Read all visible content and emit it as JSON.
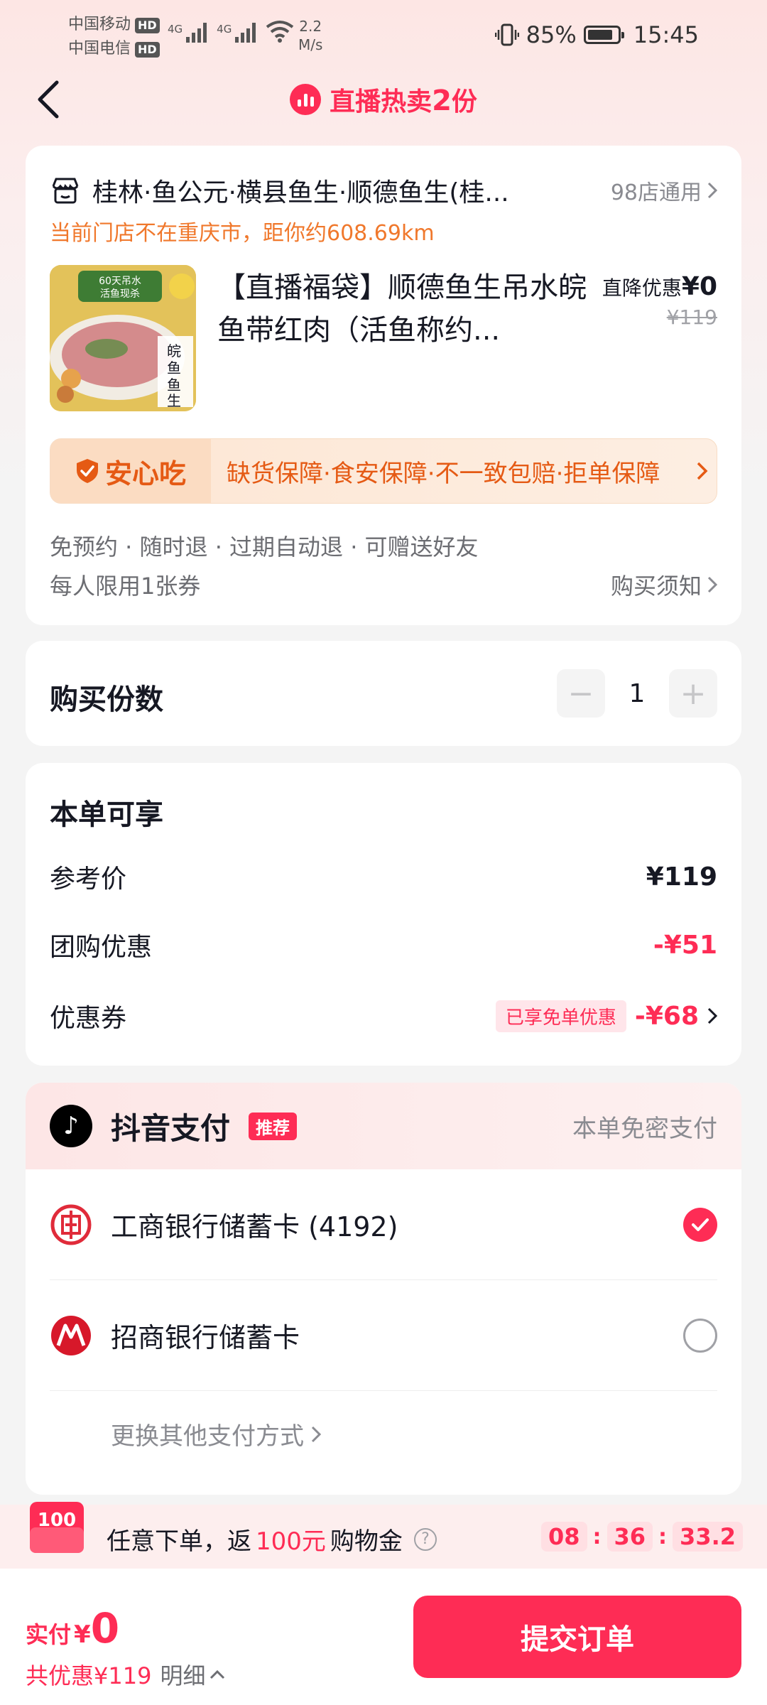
{
  "status_bar": {
    "carrier1": "中国移动",
    "carrier2": "中国电信",
    "hd": "HD",
    "net": "4G",
    "speed_val": "2.2",
    "speed_unit": "M/s",
    "battery": "85%",
    "battery_level": 0.85,
    "time": "15:45"
  },
  "nav": {
    "title_prefix": "直播热卖",
    "title_count": "2",
    "title_suffix": "份"
  },
  "store": {
    "name": "桂林·鱼公元·横县鱼生·顺德鱼生(桂...",
    "count": "98店通用",
    "warning": "当前门店不在重庆市，距你约608.69km"
  },
  "product": {
    "image_text": "皖鱼鱼生",
    "image_banner": "60天吊水 活鱼现杀",
    "title": "【直播福袋】顺德鱼生吊水皖鱼带红肉（活鱼称约...",
    "discount_label": "直降优惠",
    "discount_value": "¥0",
    "original_price": "¥119"
  },
  "guarantee": {
    "label": "安心吃",
    "text": "缺货保障·食安保障·不一致包赔·拒单保障"
  },
  "tags": "免预约 · 随时退 · 过期自动退 · 可赠送好友",
  "limit": "每人限用1张券",
  "notice": "购买须知",
  "quantity": {
    "label": "购买份数",
    "minus": "−",
    "value": "1",
    "plus": "+"
  },
  "benefits": {
    "title": "本单可享",
    "ref_label": "参考价",
    "ref_value": "¥119",
    "group_label": "团购优惠",
    "group_value": "-¥51",
    "coupon_label": "优惠券",
    "coupon_tag": "已享免单优惠",
    "coupon_value": "-¥68"
  },
  "payment": {
    "title": "抖音支付",
    "recommend": "推荐",
    "right": "本单免密支付",
    "banks": [
      {
        "name": "工商银行储蓄卡 (4192)",
        "selected": true
      },
      {
        "name": "招商银行储蓄卡",
        "selected": false
      }
    ],
    "more": "更换其他支付方式"
  },
  "promo": {
    "badge": "100",
    "text1": "任意下单，返",
    "amount": "100元",
    "text2": "购物金",
    "timer": [
      "08",
      "36",
      "33.2"
    ],
    "sep": ":"
  },
  "footer": {
    "pay_label": "实付",
    "yen": "¥",
    "pay_value": "0",
    "total_discount": "共优惠¥119",
    "detail": "明细",
    "submit": "提交订单"
  },
  "colors": {
    "accent": "#fe2c55",
    "warning": "#f0782c",
    "guarantee": "#e55a14"
  }
}
